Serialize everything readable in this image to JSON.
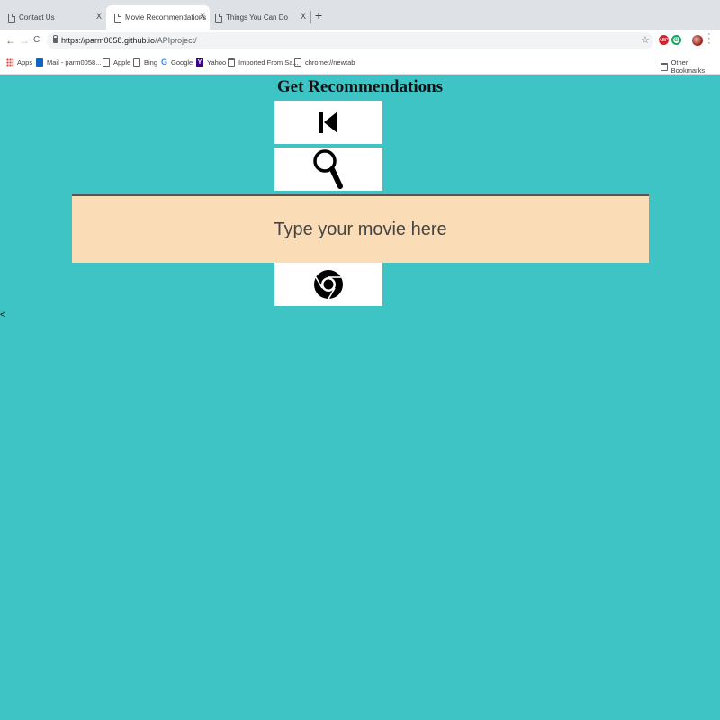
{
  "browser": {
    "tabs": [
      {
        "title": "Contact Us",
        "close": "X"
      },
      {
        "title": "Movie Recommendations",
        "close": "X"
      },
      {
        "title": "Things You Can Do",
        "close": "X"
      }
    ],
    "new_tab": "+",
    "nav": {
      "back": "←",
      "forward": "→",
      "reload": "C"
    },
    "url_host": "https://parm0058.github.io",
    "url_path": "/APIproject/",
    "star": "☆",
    "extensions": [
      {
        "label": "ABP",
        "color": "#d4222a"
      },
      {
        "label": "G",
        "color": "#1aa260"
      }
    ],
    "bookmarks": [
      {
        "label": "Apps",
        "icon": "apps-icon"
      },
      {
        "label": "Mail - parm0058...",
        "icon": "mail-icon"
      },
      {
        "label": "Apple",
        "icon": "page-icon"
      },
      {
        "label": "Bing",
        "icon": "page-icon"
      },
      {
        "label": "Google",
        "icon": "google-icon"
      },
      {
        "label": "Yahoo",
        "icon": "yahoo-icon"
      },
      {
        "label": "Imported From Sa...",
        "icon": "folder-icon"
      },
      {
        "label": "chrome://newtab",
        "icon": "page-icon"
      }
    ],
    "other_bookmarks": "Other Bookmarks"
  },
  "page": {
    "title": "Get Recommendations",
    "buttons": [
      {
        "icon": "skip-back-icon"
      },
      {
        "icon": "search-icon"
      },
      {
        "icon": "chrome-icon"
      }
    ],
    "movie_input": {
      "placeholder": "Type your movie here",
      "value": ""
    },
    "stray_text": "<"
  },
  "colors": {
    "background": "#3fc4c6",
    "input_background": "#fadcb6",
    "button_background": "#ffffff"
  }
}
